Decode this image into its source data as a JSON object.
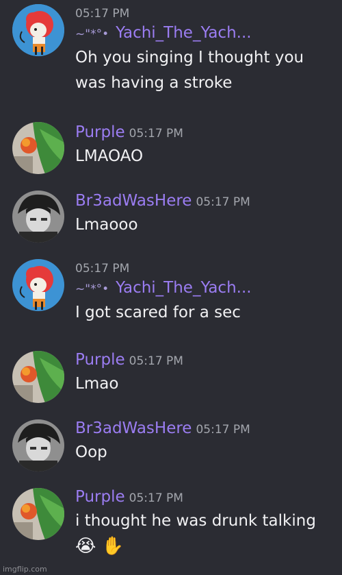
{
  "messages": [
    {
      "author": "Yachi_The_Yach...",
      "author_decor": "~\"*°•",
      "time": "05:17 PM",
      "lines": [
        "Oh you singing I thought you",
        "was having a stroke"
      ],
      "avatar": "red-hair-girl-avatar"
    },
    {
      "author": "Purple",
      "time": "05:17 PM",
      "lines": [
        "LMAOAO"
      ],
      "avatar": "flower-leaf-avatar"
    },
    {
      "author": "Br3adWasHere",
      "time": "05:17 PM",
      "lines": [
        "Lmaooo"
      ],
      "avatar": "dark-hair-character-avatar"
    },
    {
      "author": "Yachi_The_Yach...",
      "author_decor": "~\"*°•",
      "time": "05:17 PM",
      "lines": [
        "I got scared for a sec"
      ],
      "avatar": "red-hair-girl-avatar"
    },
    {
      "author": "Purple",
      "time": "05:17 PM",
      "lines": [
        "Lmao"
      ],
      "avatar": "flower-leaf-avatar"
    },
    {
      "author": "Br3adWasHere",
      "time": "05:17 PM",
      "lines": [
        "Oop"
      ],
      "avatar": "dark-hair-character-avatar"
    },
    {
      "author": "Purple",
      "time": "05:17 PM",
      "lines": [
        "i thought he was drunk talking"
      ],
      "emojis": "😭 ✋",
      "avatar": "flower-leaf-avatar"
    }
  ],
  "watermark": "imgflip.com",
  "colors": {
    "background": "#2b2c33",
    "username": "#9b7df2",
    "timestamp": "#a3a6ad",
    "message_text": "#f1f1f3"
  }
}
